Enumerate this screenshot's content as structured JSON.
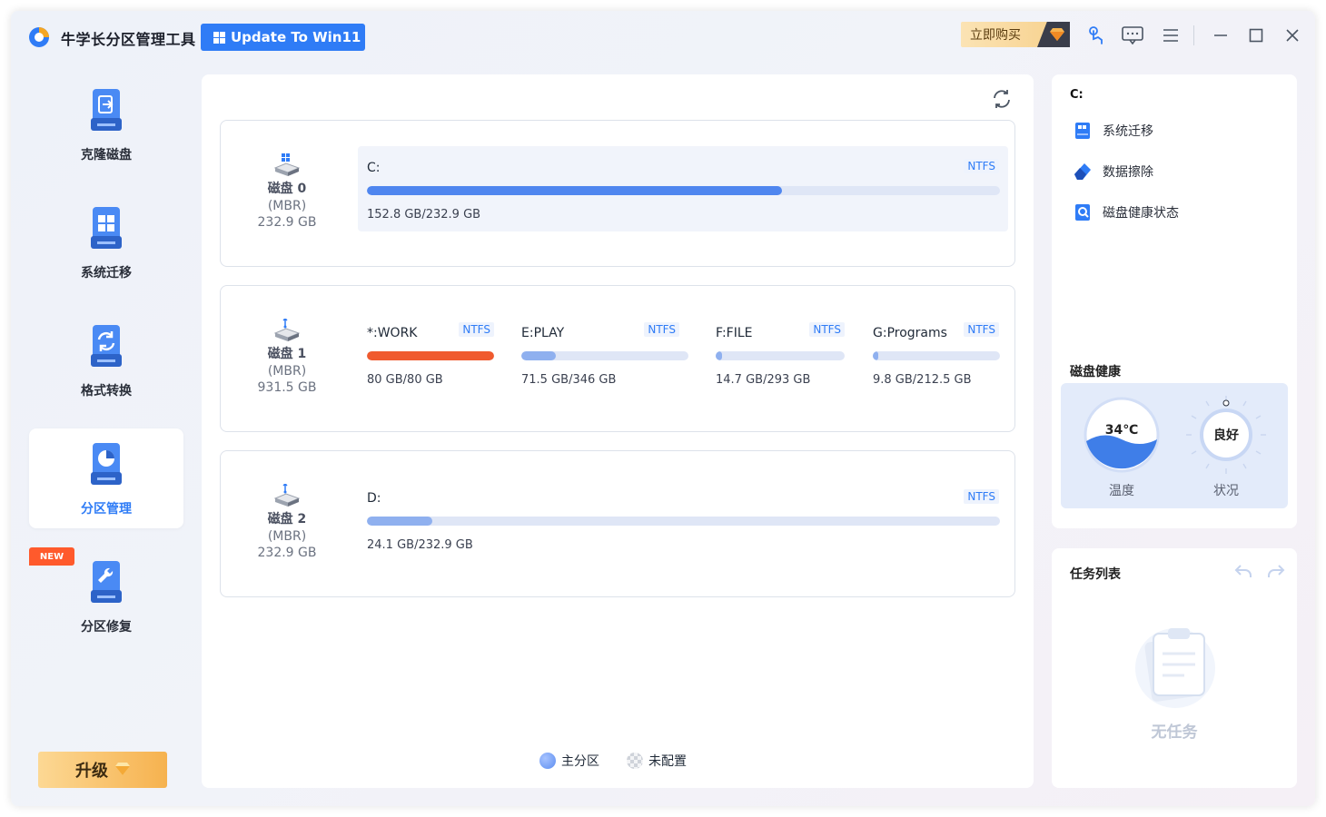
{
  "titlebar": {
    "app_name": "牛学长分区管理工具",
    "update_label": "Update To Win11",
    "buy_label": "立即购买"
  },
  "sidebar": {
    "items": [
      {
        "label": "克隆磁盘",
        "icon": "clone-disk-icon"
      },
      {
        "label": "系统迁移",
        "icon": "system-migrate-icon"
      },
      {
        "label": "格式转换",
        "icon": "format-convert-icon"
      },
      {
        "label": "分区管理",
        "icon": "partition-manage-icon",
        "active": true
      },
      {
        "label": "分区修复",
        "icon": "partition-repair-icon"
      }
    ],
    "new_badge": "NEW",
    "upgrade_label": "升级"
  },
  "disks": [
    {
      "name": "磁盘 0",
      "type": "(MBR)",
      "size": "232.9 GB",
      "partitions": [
        {
          "name": "C:",
          "fs": "NTFS",
          "usage": "152.8 GB/232.9 GB",
          "fill": 0.656,
          "color": "#4f86ef"
        }
      ]
    },
    {
      "name": "磁盘 1",
      "type": "(MBR)",
      "size": "931.5 GB",
      "partitions": [
        {
          "name": "*:WORK",
          "fs": "NTFS",
          "usage": "80 GB/80 GB",
          "fill": 1.0,
          "color": "#f05a2e"
        },
        {
          "name": "E:PLAY",
          "fs": "NTFS",
          "usage": "71.5 GB/346 GB",
          "fill": 0.207,
          "color": "#8fb0ef"
        },
        {
          "name": "F:FILE",
          "fs": "NTFS",
          "usage": "14.7 GB/293 GB",
          "fill": 0.05,
          "color": "#8fb0ef"
        },
        {
          "name": "G:Programs",
          "fs": "NTFS",
          "usage": "9.8 GB/212.5 GB",
          "fill": 0.046,
          "color": "#8fb0ef"
        }
      ]
    },
    {
      "name": "磁盘 2",
      "type": "(MBR)",
      "size": "232.9 GB",
      "partitions": [
        {
          "name": "D:",
          "fs": "NTFS",
          "usage": "24.1 GB/232.9 GB",
          "fill": 0.103,
          "color": "#8fb0ef"
        }
      ]
    }
  ],
  "legend": {
    "primary": "主分区",
    "unallocated": "未配置"
  },
  "details": {
    "selected": "C:",
    "actions": [
      {
        "label": "系统迁移",
        "icon": "system-migrate-icon"
      },
      {
        "label": "数据擦除",
        "icon": "eraser-icon"
      },
      {
        "label": "磁盘健康状态",
        "icon": "disk-health-icon"
      }
    ],
    "health_title": "磁盘健康",
    "temperature": "34℃",
    "temperature_label": "温度",
    "status": "良好",
    "status_label": "状况"
  },
  "tasks": {
    "title": "任务列表",
    "empty": "无任务"
  },
  "colors": {
    "accent": "#2f7cf6",
    "danger_fill": "#f05a2e",
    "bar_track": "#dfe6f6"
  }
}
